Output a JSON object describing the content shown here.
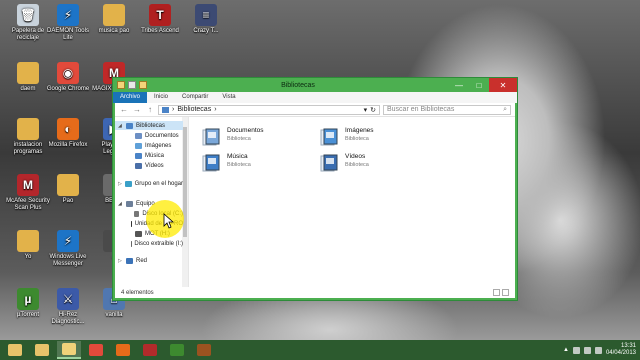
{
  "desktop": {
    "icons": [
      {
        "label": "Papelera de reciclaje",
        "glyph": "🗑",
        "color": "#c9d3dc"
      },
      {
        "label": "DAEMON Tools Lite",
        "glyph": "⚡",
        "color": "#1d74c7"
      },
      {
        "label": "musica pao",
        "glyph": "",
        "color": "#e2b24a"
      },
      {
        "label": "Tribes Ascend",
        "glyph": "T",
        "color": "#b02020"
      },
      {
        "label": "Crazy T...",
        "glyph": "≡",
        "color": "#3c4a73"
      },
      {
        "label": "daem",
        "glyph": "",
        "color": "#e2b24a"
      },
      {
        "label": "Google Chrome",
        "glyph": "◉",
        "color": "#e24a3b"
      },
      {
        "label": "MAGIX deluxe...",
        "glyph": "M",
        "color": "#c02828"
      },
      {
        "label": "instalacion programas",
        "glyph": "",
        "color": "#e2b24a"
      },
      {
        "label": "Mozilla Firefox",
        "glyph": "◐",
        "color": "#e66b1a"
      },
      {
        "label": "Play Le... Legen...",
        "glyph": "▶",
        "color": "#3d66b3"
      },
      {
        "label": "McAfee Security Scan Plus",
        "glyph": "M",
        "color": "#b3262b"
      },
      {
        "label": "Pao",
        "glyph": "",
        "color": "#e2b24a"
      },
      {
        "label": "BBQ...",
        "glyph": "",
        "color": "#6a6a6a"
      },
      {
        "label": "Yo",
        "glyph": "",
        "color": "#e2b24a"
      },
      {
        "label": "Windows Live Messenger",
        "glyph": "⚡",
        "color": "#1d74c7"
      },
      {
        "label": "...",
        "glyph": "",
        "color": "#4a4a4a"
      },
      {
        "label": "µTorrent",
        "glyph": "µ",
        "color": "#3d8a2f"
      },
      {
        "label": "Hi-Rez Diagnostic...",
        "glyph": "⚔",
        "color": "#3c5aa8"
      },
      {
        "label": "vanilla",
        "glyph": "⌂",
        "color": "#5077b0"
      }
    ]
  },
  "window": {
    "title": "Bibliotecas",
    "ribbon_tabs": [
      "Archivo",
      "Inicio",
      "Compartir",
      "Vista"
    ],
    "address": "Bibliotecas",
    "search_placeholder": "Buscar en Bibliotecas",
    "status": "4 elementos",
    "controls": {
      "minimize": "—",
      "maximize": "□",
      "close": "✕"
    },
    "nav_tree": [
      {
        "label": "Bibliotecas",
        "level": 0,
        "expanded": true,
        "selected": true,
        "color": "#4a83c7"
      },
      {
        "label": "Documentos",
        "level": 1,
        "color": "#6c8fc4"
      },
      {
        "label": "Imágenes",
        "level": 1,
        "color": "#5fa0d8"
      },
      {
        "label": "Música",
        "level": 1,
        "color": "#4a83c7"
      },
      {
        "label": "Vídeos",
        "level": 1,
        "color": "#4a6fa8"
      },
      {
        "label": "Grupo en el hogar",
        "level": 0,
        "expanded": false,
        "color": "#3aa0c8"
      },
      {
        "label": "Equipo",
        "level": 0,
        "expanded": true,
        "color": "#6c7f99"
      },
      {
        "label": "Disco local (C:)",
        "level": 1,
        "color": "#777"
      },
      {
        "label": "Unidad de BD-RO",
        "level": 1,
        "color": "#333"
      },
      {
        "label": "MOT (H:)",
        "level": 1,
        "color": "#555"
      },
      {
        "label": "Disco extraíble (I:)",
        "level": 1,
        "color": "#666"
      },
      {
        "label": "Red",
        "level": 0,
        "expanded": false,
        "color": "#3b73b8"
      }
    ],
    "libraries": [
      {
        "name": "Documentos",
        "sub": "Biblioteca",
        "icon": "documents-library-icon",
        "color": "#7aa7d9"
      },
      {
        "name": "Imágenes",
        "sub": "Biblioteca",
        "icon": "pictures-library-icon",
        "color": "#4a90d6"
      },
      {
        "name": "Música",
        "sub": "Biblioteca",
        "icon": "music-library-icon",
        "color": "#3e7ec7"
      },
      {
        "name": "Vídeos",
        "sub": "Biblioteca",
        "icon": "videos-library-icon",
        "color": "#3a6db0"
      }
    ]
  },
  "taskbar": {
    "items": [
      {
        "name": "explorer",
        "color": "#e8c36a"
      },
      {
        "name": "explorer-files",
        "color": "#f0d27a",
        "active": true
      },
      {
        "name": "chrome",
        "color": "#e24a3b"
      },
      {
        "name": "firefox",
        "color": "#e66b1a"
      },
      {
        "name": "app-4",
        "color": "#b32b2b"
      },
      {
        "name": "app-5",
        "color": "#3d8a2f"
      },
      {
        "name": "app-6",
        "color": "#9b5320"
      }
    ],
    "time": "13:31",
    "date": "04/04/2013"
  },
  "colors": {
    "accent": "#4caf50",
    "file_tab": "#1a73b8",
    "taskbar": "#2c5a2e"
  }
}
